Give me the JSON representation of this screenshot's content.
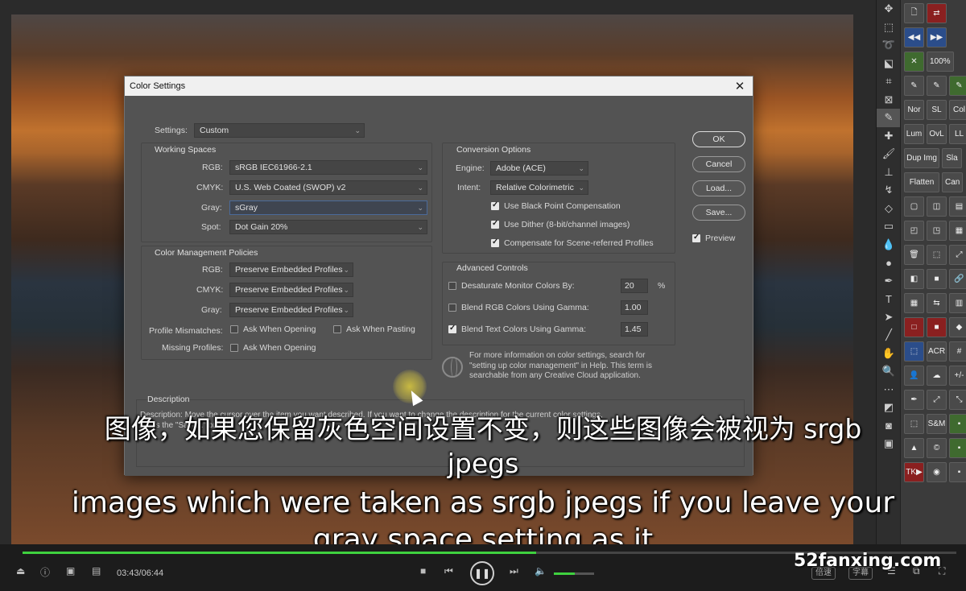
{
  "dialog": {
    "title": "Color Settings",
    "close_glyph": "✕",
    "settings_label": "Settings:",
    "settings_value": "Custom",
    "working_spaces": {
      "title": "Working Spaces",
      "rgb_label": "RGB:",
      "rgb_value": "sRGB IEC61966-2.1",
      "cmyk_label": "CMYK:",
      "cmyk_value": "U.S. Web Coated (SWOP) v2",
      "gray_label": "Gray:",
      "gray_value": "sGray",
      "spot_label": "Spot:",
      "spot_value": "Dot Gain 20%"
    },
    "policies": {
      "title": "Color Management Policies",
      "rgb_label": "RGB:",
      "rgb_value": "Preserve Embedded Profiles",
      "cmyk_label": "CMYK:",
      "cmyk_value": "Preserve Embedded Profiles",
      "gray_label": "Gray:",
      "gray_value": "Preserve Embedded Profiles",
      "mismatch_label": "Profile Mismatches:",
      "ask_opening": "Ask When Opening",
      "ask_pasting": "Ask When Pasting",
      "missing_label": "Missing Profiles:",
      "missing_ask_opening": "Ask When Opening"
    },
    "conversion": {
      "title": "Conversion Options",
      "engine_label": "Engine:",
      "engine_value": "Adobe (ACE)",
      "intent_label": "Intent:",
      "intent_value": "Relative Colorimetric",
      "bpc": "Use Black Point Compensation",
      "dither": "Use Dither (8-bit/channel images)",
      "compensate": "Compensate for Scene-referred Profiles"
    },
    "advanced": {
      "title": "Advanced Controls",
      "desaturate": "Desaturate Monitor Colors By:",
      "desaturate_value": "20",
      "desaturate_unit": "%",
      "blend_rgb": "Blend RGB Colors Using Gamma:",
      "blend_rgb_value": "1.00",
      "blend_text": "Blend Text Colors Using Gamma:",
      "blend_text_value": "1.45"
    },
    "info_text": [
      "For more information on color settings, search for",
      "\"setting up color management\" in Help. This term is",
      "searchable from any Creative Cloud application."
    ],
    "description": {
      "title": "Description",
      "line1": "Description:  Move the cursor over the item you want described.  If you want to change the description for the current color settings,",
      "line2": "press the \"Save...\" button."
    },
    "buttons": {
      "ok": "OK",
      "cancel": "Cancel",
      "load": "Load...",
      "save": "Save...",
      "preview": "Preview"
    }
  },
  "subtitles": {
    "zh_line1": "图像，如果您保留灰色空间设置不变，则这些图像会被视为 srgb",
    "zh_line2": "jpegs",
    "en_line1": "images which were taken as srgb jpegs if you leave your",
    "en_line2": "gray space setting as it"
  },
  "player": {
    "time": "03:43/06:44",
    "progress": 0.55,
    "volume": 0.52,
    "speed_chip": "倍速",
    "subtitle_chip": "字幕",
    "watermark": "52fanxing.com"
  },
  "panel": {
    "row_labels": [
      "100%",
      "Nor",
      "SL",
      "Col",
      "Lum",
      "OvL",
      "LL",
      "Dup Img",
      "Sla",
      "Flatten",
      "Can",
      "ACR",
      "+/-",
      "S&M",
      "TK▶"
    ]
  }
}
